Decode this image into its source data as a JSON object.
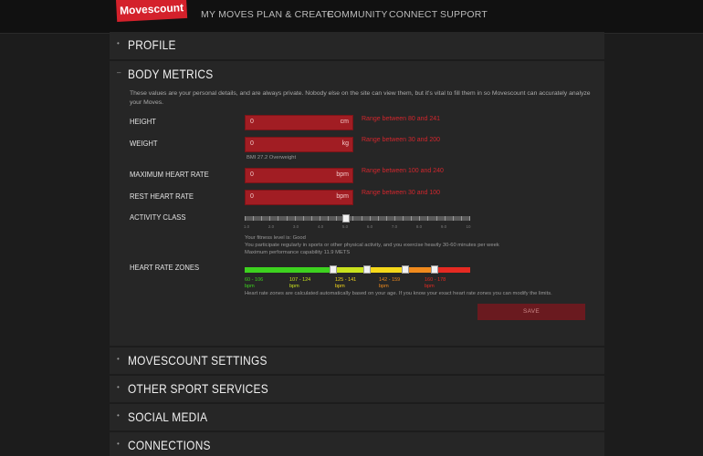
{
  "header": {
    "logo": "Movescount",
    "nav": [
      "MY MOVES",
      "PLAN & CREATE",
      "COMMUNITY",
      "CONNECT",
      "SUPPORT"
    ]
  },
  "sections": {
    "profile": "PROFILE",
    "body_metrics": "BODY METRICS",
    "movescount_settings": "MOVESCOUNT SETTINGS",
    "other_sport_services": "OTHER SPORT SERVICES",
    "social_media": "SOCIAL MEDIA",
    "connections": "CONNECTIONS"
  },
  "body_metrics": {
    "intro": "These values are your personal details, and are always private. Nobody else on the site can view them, but it's vital to fill them in so Movescount can accurately analyze your Moves.",
    "height": {
      "label": "HEIGHT",
      "value": "0",
      "unit": "cm",
      "range": "Range between 80 and 241"
    },
    "weight": {
      "label": "WEIGHT",
      "value": "0",
      "unit": "kg",
      "range": "Range between 30 and 200"
    },
    "bmi": "BMI  27.2  Overweight",
    "max_hr": {
      "label": "MAXIMUM HEART RATE",
      "value": "0",
      "unit": "bpm",
      "range": "Range between 100 and 240"
    },
    "rest_hr": {
      "label": "REST HEART RATE",
      "value": "0",
      "unit": "bpm",
      "range": "Range between 30 and 100"
    },
    "activity_class": {
      "label": "ACTIVITY CLASS",
      "ticks": [
        "1.0",
        "2.0",
        "3.0",
        "4.0",
        "5.0",
        "6.0",
        "7.0",
        "8.0",
        "9.0",
        "10"
      ],
      "level_fraction": 0.45,
      "fitness_level": "Your fitness level is: Good",
      "description": "You participate regularly in sports or other physical activity, and you exercise heavily  30-60 minutes per week",
      "performance": "Maximum performance capability 11.9 METS"
    },
    "heart_rate_zones": {
      "label": "HEART RATE ZONES",
      "zones": [
        {
          "range": "60 - 106",
          "unit": "bpm",
          "color": "#3dd21f"
        },
        {
          "range": "107 - 124",
          "unit": "bpm",
          "color": "#c9e21e"
        },
        {
          "range": "125 - 141",
          "unit": "bpm",
          "color": "#f5d81a"
        },
        {
          "range": "142 - 159",
          "unit": "bpm",
          "color": "#f08a1d"
        },
        {
          "range": "160 - 178",
          "unit": "bpm",
          "color": "#e62a22"
        }
      ],
      "note": "Heart rate zones are calculated automatically based on your age. If you know your exact heart rate zones you can modify the limits."
    },
    "save_label": "SAVE"
  }
}
